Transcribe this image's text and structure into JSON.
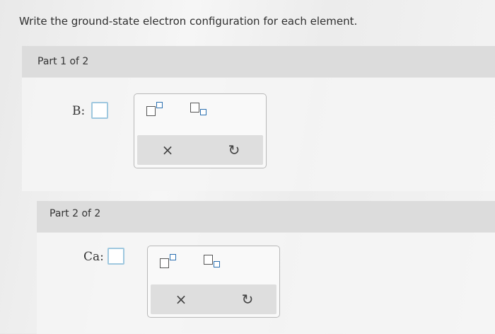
{
  "question": "Write the ground-state electron configuration for each element.",
  "parts": [
    {
      "header": "Part 1 of 2",
      "element": "B:"
    },
    {
      "header": "Part 2 of 2",
      "element": "Ca:"
    }
  ],
  "palette": {
    "superscript_icon": "superscript-icon",
    "subscript_icon": "subscript-icon",
    "clear_symbol": "×",
    "undo_symbol": "↻"
  }
}
